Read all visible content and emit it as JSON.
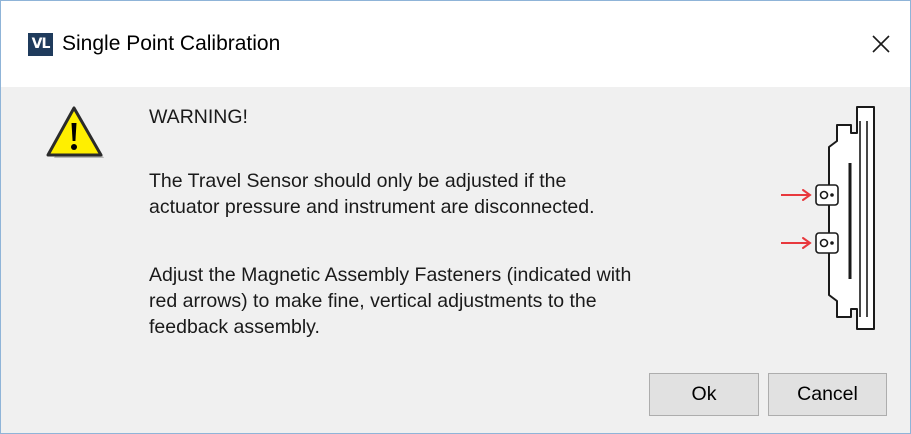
{
  "window": {
    "logo_text": "VL",
    "title": "Single Point Calibration",
    "close_icon": "close-icon"
  },
  "message": {
    "icon": "warning-icon",
    "heading": "WARNING!",
    "paragraph1_line1": "The Travel Sensor should only be adjusted if the",
    "paragraph1_line2": "actuator pressure and instrument are disconnected.",
    "paragraph2_line1": "Adjust the Magnetic Assembly Fasteners (indicated with",
    "paragraph2_line2": "red arrows) to make fine, vertical adjustments to the",
    "paragraph2_line3": "feedback assembly."
  },
  "diagram": {
    "icon": "magnetic-assembly-diagram",
    "arrow_color": "#e8383d"
  },
  "buttons": {
    "ok_label": "Ok",
    "cancel_label": "Cancel"
  },
  "colors": {
    "title_bar": "#ffffff",
    "dialog_body": "#f0f0f0",
    "window_border": "#8fb4d8",
    "button_face": "#e1e1e1",
    "warning_yellow": "#ffef00"
  }
}
